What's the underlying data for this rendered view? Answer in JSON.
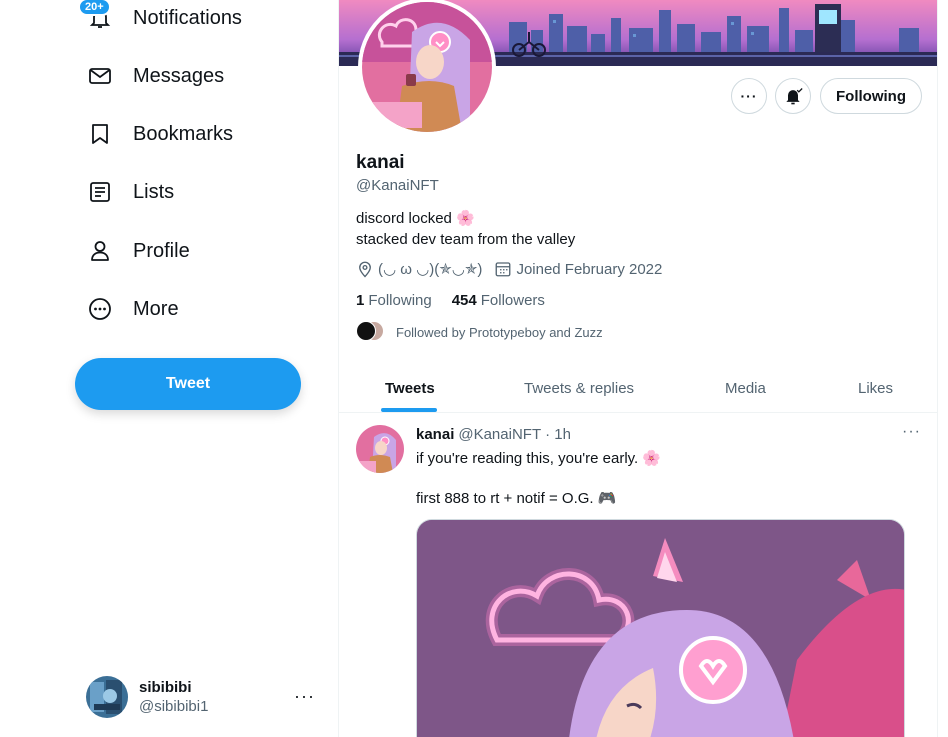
{
  "sidebar": {
    "nav": [
      {
        "label": "Notifications",
        "icon": "bell-icon",
        "badge": "20+"
      },
      {
        "label": "Messages",
        "icon": "envelope-icon"
      },
      {
        "label": "Bookmarks",
        "icon": "bookmark-icon"
      },
      {
        "label": "Lists",
        "icon": "list-icon"
      },
      {
        "label": "Profile",
        "icon": "person-icon"
      },
      {
        "label": "More",
        "icon": "more-circle-icon"
      }
    ],
    "tweet_button": "Tweet",
    "account": {
      "name": "sibibibi",
      "handle": "@sibibibi1",
      "more": "···"
    }
  },
  "profile": {
    "name": "kanai",
    "handle": "@KanaiNFT",
    "bio_line1": "discord locked 🌸",
    "bio_line2": "stacked dev team from the valley",
    "location": "(◡ ω ◡)(✯◡✯)",
    "joined": "Joined February 2022",
    "following_count": "1",
    "following_label": "Following",
    "followers_count": "454",
    "followers_label": "Followers",
    "followed_by": "Followed by Prototypeboy and Zuzz",
    "following_button": "Following",
    "more_button": "···"
  },
  "tabs": [
    {
      "label": "Tweets",
      "active": true
    },
    {
      "label": "Tweets & replies",
      "active": false
    },
    {
      "label": "Media",
      "active": false
    },
    {
      "label": "Likes",
      "active": false
    }
  ],
  "tweet": {
    "author": "kanai",
    "handle": "@KanaiNFT",
    "time": "· 1h",
    "line1": "if you're reading this, you're early. 🌸",
    "line2": "first 888 to rt + notif = O.G. 🎮",
    "more": "···"
  },
  "colors": {
    "accent": "#1d9bf0",
    "text": "#0f1419",
    "secondary": "#536471",
    "border": "#eff3f4"
  }
}
